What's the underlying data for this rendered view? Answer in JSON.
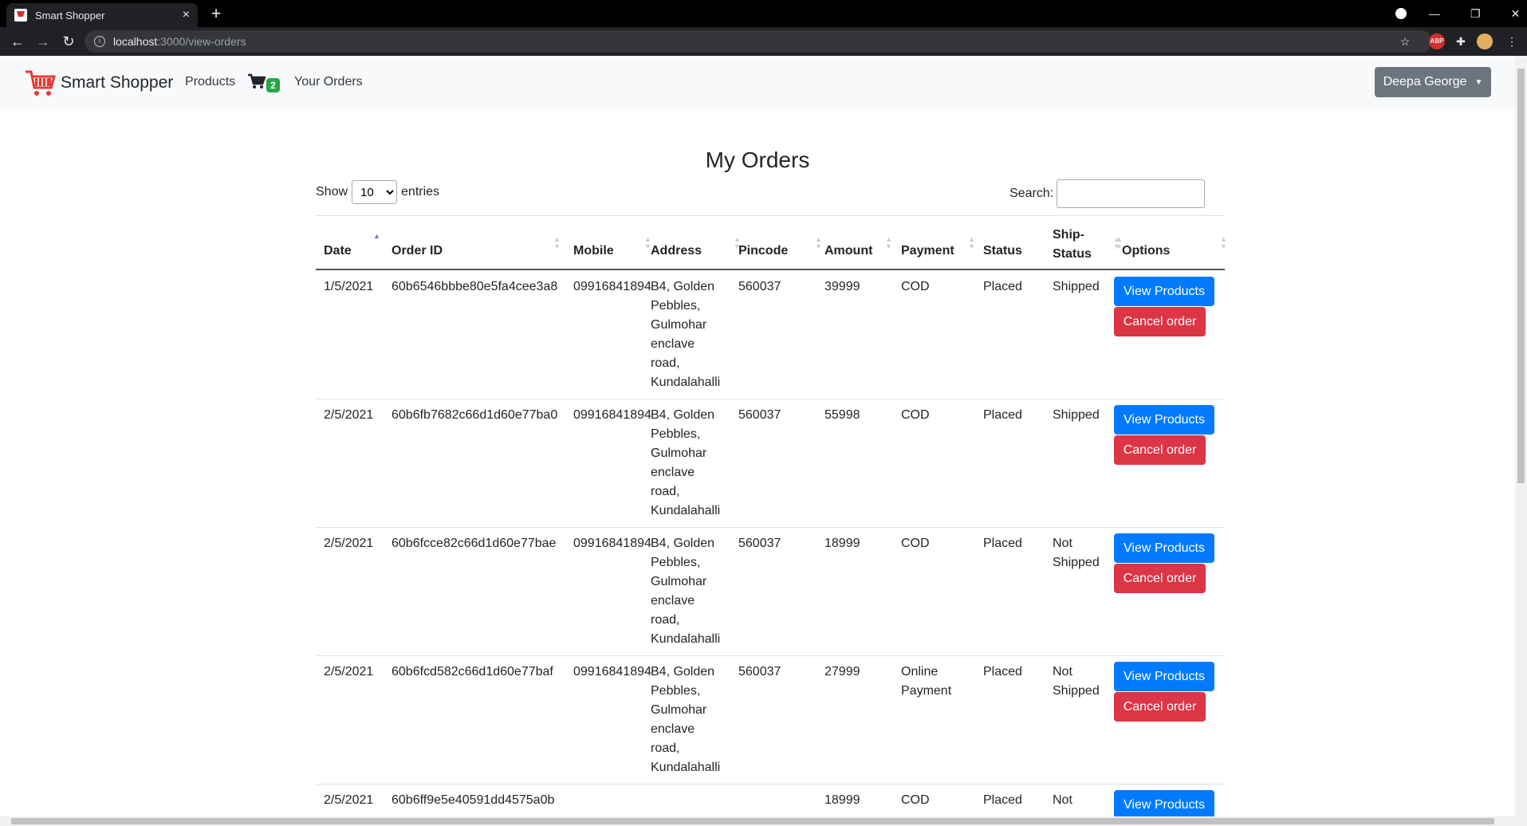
{
  "browser": {
    "tab_title": "Smart Shopper",
    "url_host": "localhost",
    "url_path": ":3000/view-orders",
    "new_tab": "+",
    "close_tab": "×"
  },
  "navbar": {
    "brand": "Smart Shopper",
    "products": "Products",
    "cart_count": "2",
    "your_orders": "Your Orders",
    "user": "Deepa George"
  },
  "page": {
    "title": "My Orders",
    "show_label": "Show",
    "entries_label": "entries",
    "entries_value": "10",
    "search_label": "Search:"
  },
  "table": {
    "headers": [
      "Date",
      "Order ID",
      "Mobile",
      "Address",
      "Pincode",
      "Amount",
      "Payment",
      "Status",
      "Ship-Status",
      "Options"
    ],
    "headers_ship_line1": "Ship-",
    "headers_ship_line2": "Status",
    "view_label": "View Products",
    "cancel_label": "Cancel order",
    "rows": [
      {
        "date": "1/5/2021",
        "order_id": "60b6546bbbe80e5fa4cee3a8",
        "mobile": "09916841894",
        "address": [
          "B4, Golden",
          "Pebbles,",
          "Gulmohar",
          "enclave",
          "road,",
          "Kundalahalli"
        ],
        "pincode": "560037",
        "amount": "39999",
        "payment": [
          "COD"
        ],
        "status": "Placed",
        "ship": [
          "Shipped"
        ]
      },
      {
        "date": "2/5/2021",
        "order_id": "60b6fb7682c66d1d60e77ba0",
        "mobile": "09916841894",
        "address": [
          "B4, Golden",
          "Pebbles,",
          "Gulmohar",
          "enclave",
          "road,",
          "Kundalahalli"
        ],
        "pincode": "560037",
        "amount": "55998",
        "payment": [
          "COD"
        ],
        "status": "Placed",
        "ship": [
          "Shipped"
        ]
      },
      {
        "date": "2/5/2021",
        "order_id": "60b6fcce82c66d1d60e77bae",
        "mobile": "09916841894",
        "address": [
          "B4, Golden",
          "Pebbles,",
          "Gulmohar",
          "enclave",
          "road,",
          "Kundalahalli"
        ],
        "pincode": "560037",
        "amount": "18999",
        "payment": [
          "COD"
        ],
        "status": "Placed",
        "ship": [
          "Not",
          "Shipped"
        ]
      },
      {
        "date": "2/5/2021",
        "order_id": "60b6fcd582c66d1d60e77baf",
        "mobile": "09916841894",
        "address": [
          "B4, Golden",
          "Pebbles,",
          "Gulmohar",
          "enclave",
          "road,",
          "Kundalahalli"
        ],
        "pincode": "560037",
        "amount": "27999",
        "payment": [
          "Online",
          "Payment"
        ],
        "status": "Placed",
        "ship": [
          "Not",
          "Shipped"
        ]
      },
      {
        "date": "2/5/2021",
        "order_id": "60b6ff9e5e40591dd4575a0b",
        "mobile": "",
        "address": [],
        "pincode": "",
        "amount": "18999",
        "payment": [
          "COD"
        ],
        "status": "Placed",
        "ship": [
          "Not"
        ]
      }
    ]
  },
  "colors": {
    "primary": "#007bff",
    "danger": "#dc3545",
    "secondary": "#6c757d",
    "badge": "#28a745"
  }
}
